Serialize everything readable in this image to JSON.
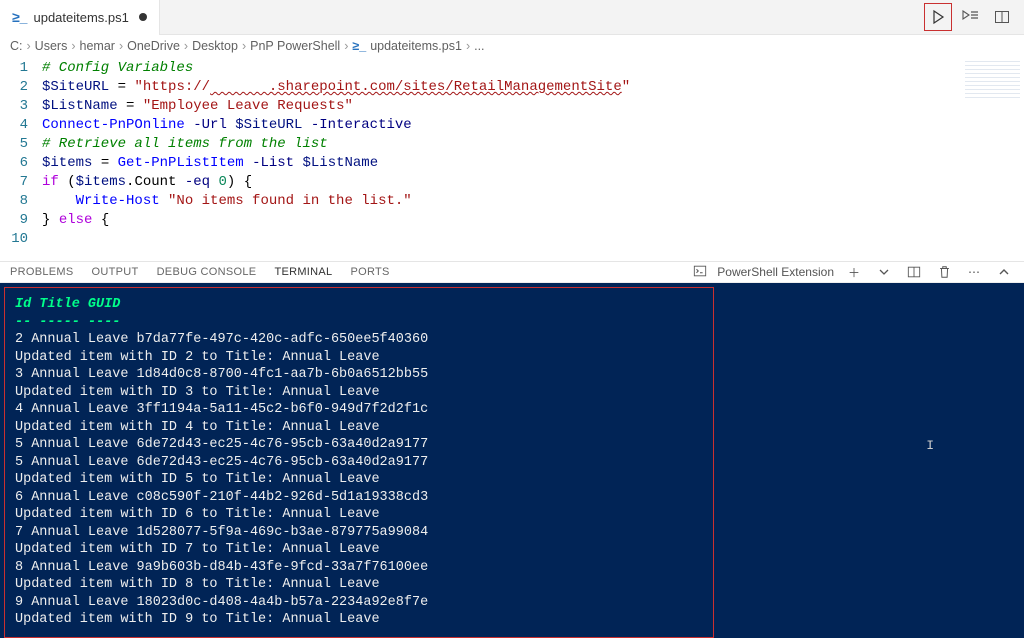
{
  "tab": {
    "icon": "≥_",
    "label": "updateitems.ps1",
    "dirty": true
  },
  "toolbar": {
    "run": "▷",
    "runPanel": "▷≡",
    "split": "▯▯"
  },
  "breadcrumb": [
    "C:",
    "Users",
    "hemar",
    "OneDrive",
    "Desktop",
    "PnP PowerShell"
  ],
  "breadcrumbFile": "updateitems.ps1",
  "breadcrumbTail": "...",
  "code": {
    "lines": [
      {
        "n": 1,
        "tokens": [
          [
            "comment",
            "# Config Variables"
          ]
        ]
      },
      {
        "n": 2,
        "tokens": [
          [
            "var",
            "$SiteURL"
          ],
          [
            "plain",
            " = "
          ],
          [
            "str",
            "\"https://"
          ],
          [
            "url",
            "       .sharepoint.com/sites/RetailManagementSite"
          ],
          [
            "str",
            "\""
          ]
        ]
      },
      {
        "n": 3,
        "tokens": [
          [
            "var",
            "$ListName"
          ],
          [
            "plain",
            " = "
          ],
          [
            "str",
            "\"Employee Leave Requests\""
          ]
        ]
      },
      {
        "n": 4,
        "tokens": [
          [
            "plain",
            ""
          ]
        ]
      },
      {
        "n": 5,
        "tokens": [
          [
            "cmd",
            "Connect-PnPOnline"
          ],
          [
            "plain",
            " "
          ],
          [
            "param",
            "-Url"
          ],
          [
            "plain",
            " "
          ],
          [
            "var",
            "$SiteURL"
          ],
          [
            "plain",
            " "
          ],
          [
            "param",
            "-Interactive"
          ]
        ]
      },
      {
        "n": 6,
        "tokens": [
          [
            "comment",
            "# Retrieve all items from the list"
          ]
        ]
      },
      {
        "n": 7,
        "tokens": [
          [
            "var",
            "$items"
          ],
          [
            "plain",
            " = "
          ],
          [
            "cmd",
            "Get-PnPListItem"
          ],
          [
            "plain",
            " "
          ],
          [
            "param",
            "-List"
          ],
          [
            "plain",
            " "
          ],
          [
            "var",
            "$ListName"
          ]
        ]
      },
      {
        "n": 8,
        "tokens": [
          [
            "kw",
            "if"
          ],
          [
            "plain",
            " ("
          ],
          [
            "var",
            "$items"
          ],
          [
            "plain",
            ".Count "
          ],
          [
            "param",
            "-eq"
          ],
          [
            "plain",
            " "
          ],
          [
            "num",
            "0"
          ],
          [
            "plain",
            ") {"
          ]
        ]
      },
      {
        "n": 9,
        "tokens": [
          [
            "plain",
            "    "
          ],
          [
            "cmd",
            "Write-Host"
          ],
          [
            "plain",
            " "
          ],
          [
            "str",
            "\"No items found in the list.\""
          ]
        ]
      },
      {
        "n": 10,
        "tokens": [
          [
            "plain",
            "} "
          ],
          [
            "kw",
            "else"
          ],
          [
            "plain",
            " {"
          ]
        ]
      }
    ]
  },
  "panelTabs": [
    "PROBLEMS",
    "OUTPUT",
    "DEBUG CONSOLE",
    "TERMINAL",
    "PORTS"
  ],
  "panelActiveTab": "TERMINAL",
  "terminalKind": "PowerShell Extension",
  "terminal": {
    "h_id": "Id",
    "h_title": "Title",
    "h_guid": "GUID",
    "dash_id": "--",
    "dash_title": "-----",
    "dash_guid": "----",
    "rows": [
      {
        "type": "item",
        "id": "2",
        "title": "Annual Leave",
        "guid": "b7da77fe-497c-420c-adfc-650ee5f40360"
      },
      {
        "type": "msg",
        "text": "Updated item with ID 2 to Title: Annual Leave"
      },
      {
        "type": "item",
        "id": "3",
        "title": "Annual Leave",
        "guid": "1d84d0c8-8700-4fc1-aa7b-6b0a6512bb55"
      },
      {
        "type": "msg",
        "text": "Updated item with ID 3 to Title: Annual Leave"
      },
      {
        "type": "item",
        "id": "4",
        "title": "Annual Leave",
        "guid": "3ff1194a-5a11-45c2-b6f0-949d7f2d2f1c"
      },
      {
        "type": "msg",
        "text": "Updated item with ID 4 to Title: Annual Leave"
      },
      {
        "type": "item",
        "id": "5",
        "title": "Annual Leave",
        "guid": "6de72d43-ec25-4c76-95cb-63a40d2a9177"
      },
      {
        "type": "item",
        "id": "5",
        "title": "Annual Leave",
        "guid": "6de72d43-ec25-4c76-95cb-63a40d2a9177"
      },
      {
        "type": "msg",
        "text": "Updated item with ID 5 to Title: Annual Leave"
      },
      {
        "type": "item",
        "id": "6",
        "title": "Annual Leave",
        "guid": "c08c590f-210f-44b2-926d-5d1a19338cd3"
      },
      {
        "type": "msg",
        "text": "Updated item with ID 6 to Title: Annual Leave"
      },
      {
        "type": "item",
        "id": "7",
        "title": "Annual Leave",
        "guid": "1d528077-5f9a-469c-b3ae-879775a99084"
      },
      {
        "type": "msg",
        "text": "Updated item with ID 7 to Title: Annual Leave"
      },
      {
        "type": "item",
        "id": "8",
        "title": "Annual Leave",
        "guid": "9a9b603b-d84b-43fe-9fcd-33a7f76100ee"
      },
      {
        "type": "msg",
        "text": "Updated item with ID 8 to Title: Annual Leave"
      },
      {
        "type": "item",
        "id": "9",
        "title": "Annual Leave",
        "guid": "18023d0c-d408-4a4b-b57a-2234a92e8f7e"
      },
      {
        "type": "msg",
        "text": "Updated item with ID 9 to Title: Annual Leave"
      }
    ]
  }
}
